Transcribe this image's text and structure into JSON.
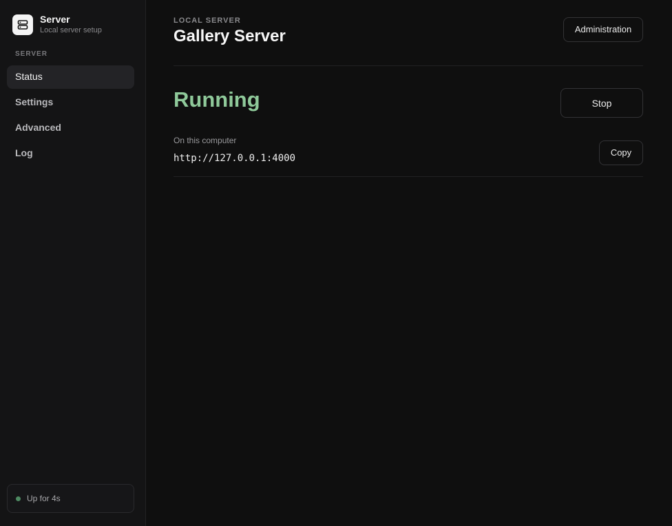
{
  "sidebar": {
    "brand": {
      "title": "Server",
      "subtitle": "Local server setup",
      "icon": "server-icon"
    },
    "section_label": "SERVER",
    "items": [
      {
        "label": "Status",
        "active": true
      },
      {
        "label": "Settings",
        "active": false
      },
      {
        "label": "Advanced",
        "active": false
      },
      {
        "label": "Log",
        "active": false
      }
    ],
    "uptime": "Up for 4s"
  },
  "header": {
    "eyebrow": "LOCAL SERVER",
    "title": "Gallery Server",
    "admin_label": "Administration"
  },
  "status": {
    "label": "Running",
    "stop_label": "Stop"
  },
  "address": {
    "label": "On this computer",
    "value": "http://127.0.0.1:4000",
    "copy_label": "Copy"
  },
  "colors": {
    "running": "#8fc99a",
    "uptime_dot": "#4e8a62",
    "background": "#0f0f0f",
    "sidebar": "#141415"
  }
}
